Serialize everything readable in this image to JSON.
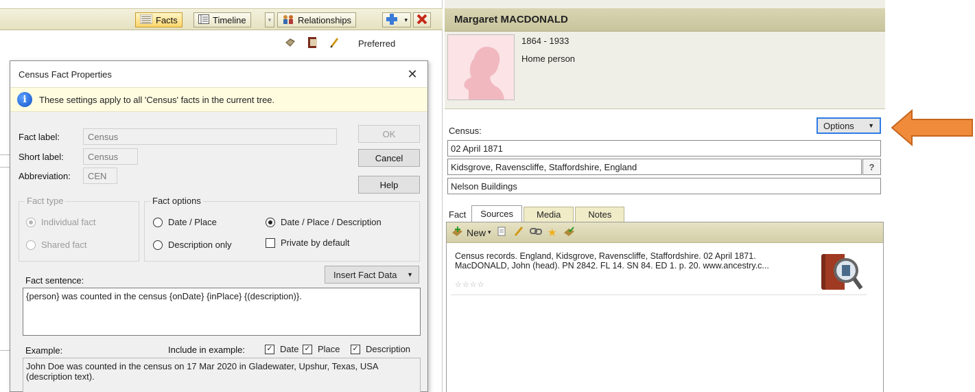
{
  "toolbar": {
    "facts_label": "Facts",
    "timeline_label": "Timeline",
    "relationships_label": "Relationships"
  },
  "column_header": {
    "preferred_label": "Preferred"
  },
  "dialog": {
    "title": "Census Fact Properties",
    "info_text": "These settings apply to all 'Census' facts in the current tree.",
    "fact_label_label": "Fact label:",
    "fact_label_value": "Census",
    "short_label_label": "Short label:",
    "short_label_value": "Census",
    "abbreviation_label": "Abbreviation:",
    "abbreviation_value": "CEN",
    "ok_label": "OK",
    "cancel_label": "Cancel",
    "help_label": "Help",
    "fact_type": {
      "title": "Fact type",
      "individual": "Individual fact",
      "shared": "Shared fact"
    },
    "fact_options": {
      "title": "Fact options",
      "date_place": "Date / Place",
      "date_place_description": "Date / Place / Description",
      "description_only": "Description only",
      "private_by_default": "Private by default"
    },
    "fact_sentence_label": "Fact sentence:",
    "insert_fact_data_label": "Insert Fact Data",
    "fact_sentence_value": "{person} was counted in the census {onDate} {inPlace} {(description)}.",
    "example_label": "Example:",
    "include_in_example_label": "Include in example:",
    "include_date": "Date",
    "include_place": "Place",
    "include_description": "Description",
    "example_text": "John Doe was counted in the census on 17 Mar 2020 in Gladewater, Upshur, Texas, USA (description text)."
  },
  "person": {
    "name": "Margaret MACDONALD",
    "dates": "1864 - 1933",
    "status": "Home person"
  },
  "fact_panel": {
    "fact_name": "Census:",
    "options_label": "Options",
    "date_value": "02 April 1871",
    "place_value": "Kidsgrove, Ravenscliffe, Staffordshire, England",
    "description_value": "Nelson Buildings",
    "tabs": {
      "fact": "Fact",
      "sources": "Sources",
      "media": "Media",
      "notes": "Notes"
    },
    "new_label": "New",
    "source_citation": "Census records. England, Kidsgrove, Ravenscliffe, Staffordshire. 02 April 1871. MacDONALD, John (head). PN 2842. FL 14. SN 84. ED 1. p. 20. www.ancestry.c...",
    "source_stars": "☆☆☆☆"
  },
  "colors": {
    "toolbar_bg": "#e5e1c1",
    "header_bg": "#c8c49d",
    "info_bg": "#fffce0",
    "options_border": "#2c7be5",
    "arrow": "#ef8b3a"
  }
}
